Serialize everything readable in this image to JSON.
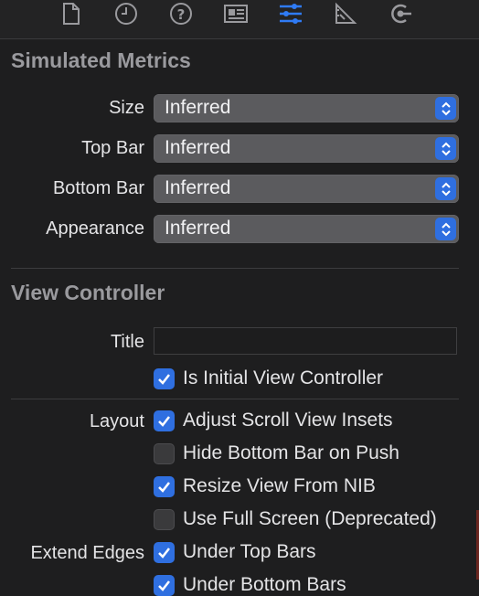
{
  "colors": {
    "accent": "#2f6fe0",
    "background": "#1e1e1f",
    "popup": "#5b5b5e"
  },
  "tabs": [
    {
      "icon": "file-icon",
      "selected": false
    },
    {
      "icon": "history-icon",
      "selected": false
    },
    {
      "icon": "help-icon",
      "selected": false
    },
    {
      "icon": "identity-icon",
      "selected": false
    },
    {
      "icon": "attributes-sliders-icon",
      "selected": true
    },
    {
      "icon": "size-ruler-icon",
      "selected": false
    },
    {
      "icon": "connections-icon",
      "selected": false
    }
  ],
  "simulated_metrics": {
    "title": "Simulated Metrics",
    "size": {
      "label": "Size",
      "value": "Inferred"
    },
    "top_bar": {
      "label": "Top Bar",
      "value": "Inferred"
    },
    "bottom_bar": {
      "label": "Bottom Bar",
      "value": "Inferred"
    },
    "appearance": {
      "label": "Appearance",
      "value": "Inferred"
    }
  },
  "view_controller": {
    "title": "View Controller",
    "title_field": {
      "label": "Title",
      "value": ""
    },
    "is_initial": {
      "label": "Is Initial View Controller",
      "checked": true
    },
    "layout": {
      "label": "Layout",
      "adjust_scroll": {
        "label": "Adjust Scroll View Insets",
        "checked": true
      },
      "hide_bottom_bar": {
        "label": "Hide Bottom Bar on Push",
        "checked": false
      },
      "resize_from_nib": {
        "label": "Resize View From NIB",
        "checked": true
      },
      "use_full_screen": {
        "label": "Use Full Screen (Deprecated)",
        "checked": false
      }
    },
    "extend_edges": {
      "label": "Extend Edges",
      "under_top_bars": {
        "label": "Under Top Bars",
        "checked": true
      },
      "under_bottom_bars": {
        "label": "Under Bottom Bars",
        "checked": true
      }
    }
  }
}
